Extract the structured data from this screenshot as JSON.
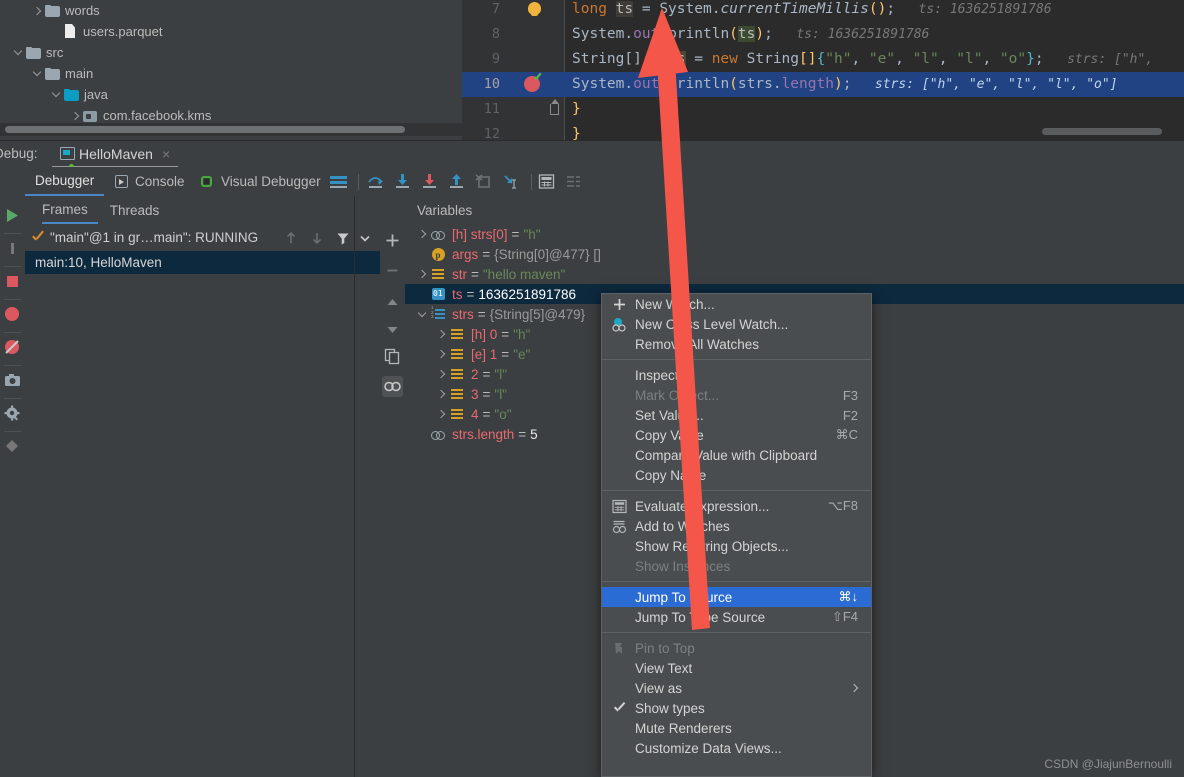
{
  "project_tree": {
    "items": [
      {
        "label": "words",
        "icon": "folder-icon",
        "indent": 1,
        "twisty": "right"
      },
      {
        "label": "users.parquet",
        "icon": "file-icon",
        "indent": 2,
        "twisty": "none"
      },
      {
        "label": "src",
        "icon": "folder-icon",
        "indent": 0,
        "twisty": "down"
      },
      {
        "label": "main",
        "icon": "folder-icon",
        "indent": 1,
        "twisty": "down"
      },
      {
        "label": "java",
        "icon": "source-folder-icon",
        "indent": 2,
        "twisty": "down"
      },
      {
        "label": "com.facebook.kms",
        "icon": "package-icon",
        "indent": 3,
        "twisty": "right"
      }
    ]
  },
  "editor": {
    "lines": [
      {
        "num": "7",
        "selected": false,
        "gutter": "bulb-icon",
        "tokens": [
          {
            "t": "long",
            "c": "k"
          },
          {
            "t": " ",
            "c": "pn"
          },
          {
            "t": "ts",
            "c": "varhl"
          },
          {
            "t": " = ",
            "c": "pn"
          },
          {
            "t": "System",
            "c": "cls"
          },
          {
            "t": ".",
            "c": "pn"
          },
          {
            "t": "currentTimeMillis",
            "c": "mtd"
          },
          {
            "t": "(",
            "c": "brk"
          },
          {
            "t": ")",
            "c": "brk"
          },
          {
            "t": ";",
            "c": "pn"
          }
        ],
        "hint": "ts: 1636251891786"
      },
      {
        "num": "8",
        "selected": false,
        "gutter": "none",
        "tokens": [
          {
            "t": "System",
            "c": "cls"
          },
          {
            "t": ".",
            "c": "pn"
          },
          {
            "t": "out",
            "c": "fld-i"
          },
          {
            "t": ".",
            "c": "pn"
          },
          {
            "t": "println",
            "c": "cls"
          },
          {
            "t": "(",
            "c": "brk"
          },
          {
            "t": "ts",
            "c": "varhl2"
          },
          {
            "t": ")",
            "c": "brk"
          },
          {
            "t": ";",
            "c": "pn"
          }
        ],
        "hint": "ts: 1636251891786"
      },
      {
        "num": "9",
        "selected": false,
        "gutter": "none",
        "tokens": [
          {
            "t": "String[]",
            "c": "cls"
          },
          {
            "t": " ",
            "c": "pn"
          },
          {
            "t": "strs",
            "c": "varhl3"
          },
          {
            "t": " = ",
            "c": "pn"
          },
          {
            "t": "new",
            "c": "k"
          },
          {
            "t": " ",
            "c": "pn"
          },
          {
            "t": "String",
            "c": "cls"
          },
          {
            "t": "[]",
            "c": "brk"
          },
          {
            "t": "{",
            "c": "br2"
          },
          {
            "t": "\"h\"",
            "c": "str"
          },
          {
            "t": ", ",
            "c": "pn"
          },
          {
            "t": "\"e\"",
            "c": "str"
          },
          {
            "t": ", ",
            "c": "pn"
          },
          {
            "t": "\"l\"",
            "c": "str"
          },
          {
            "t": ", ",
            "c": "pn"
          },
          {
            "t": "\"l\"",
            "c": "str"
          },
          {
            "t": ", ",
            "c": "pn"
          },
          {
            "t": "\"o\"",
            "c": "str"
          },
          {
            "t": "}",
            "c": "br2"
          },
          {
            "t": ";",
            "c": "pn"
          }
        ],
        "hint": "strs: [\"h\","
      },
      {
        "num": "10",
        "selected": true,
        "gutter": "breakpoint-verified-icon",
        "tokens": [
          {
            "t": "System",
            "c": "cls"
          },
          {
            "t": ".",
            "c": "pn"
          },
          {
            "t": "out",
            "c": "fld-i"
          },
          {
            "t": ".",
            "c": "pn"
          },
          {
            "t": "println",
            "c": "cls"
          },
          {
            "t": "(",
            "c": "brk"
          },
          {
            "t": "strs",
            "c": "pn"
          },
          {
            "t": ".",
            "c": "pn"
          },
          {
            "t": "length",
            "c": "fld"
          },
          {
            "t": ")",
            "c": "brk"
          },
          {
            "t": ";",
            "c": "pn"
          }
        ],
        "hint": "strs: [\"h\", \"e\", \"l\", \"l\", \"o\"]"
      },
      {
        "num": "11",
        "selected": false,
        "gutter": "fold-end-icon",
        "tokens": [
          {
            "t": "}",
            "c": "brk"
          }
        ],
        "hint": ""
      },
      {
        "num": "12",
        "selected": false,
        "gutter": "none",
        "tokens": [
          {
            "t": "}",
            "c": "brk"
          }
        ],
        "hint": ""
      }
    ]
  },
  "debug_panel": {
    "label": "Debug:",
    "session_tab": "HelloMaven",
    "session_close": "×",
    "tabs": [
      {
        "label": "Debugger",
        "icon": "none",
        "active": true
      },
      {
        "label": "Console",
        "icon": "console-icon",
        "active": false
      },
      {
        "label": "Visual Debugger",
        "icon": "visual-debugger-icon",
        "active": false
      }
    ],
    "toolbar_icons": [
      "layout-settings-icon",
      "step-over-icon",
      "step-into-icon",
      "force-step-into-icon",
      "step-out-icon",
      "drop-frame-icon",
      "run-to-cursor-icon",
      "evaluate-expression-icon",
      "trace-icon"
    ]
  },
  "frames": {
    "tabs": [
      {
        "label": "Frames",
        "active": true
      },
      {
        "label": "Threads",
        "active": false
      }
    ],
    "thread": "\"main\"@1 in gr…main\": RUNNING",
    "thread_icons": [
      "arrow-up-icon",
      "arrow-down-icon",
      "filter-icon",
      "chevron-down-icon"
    ],
    "stack": [
      {
        "label": "main:10, HelloMaven",
        "selected": true
      }
    ]
  },
  "vars_toolbar": {
    "icons": [
      "add-watch-icon",
      "remove-watch-icon",
      "move-up-icon",
      "move-down-icon",
      "copy-icon",
      "watches-icon"
    ]
  },
  "variables": {
    "header": "Variables",
    "rows": [
      {
        "indent": 0,
        "twisty": "right",
        "icon": "watch-icon",
        "prefix": "[h]",
        "name": "strs[0]",
        "eq": "=",
        "value": "\"h\"",
        "vtype": "string",
        "selected": false
      },
      {
        "indent": 0,
        "twisty": "none",
        "icon": "param-icon",
        "prefix": "",
        "name": "args",
        "eq": "=",
        "value": "{String[0]@477} []",
        "vtype": "object",
        "selected": false
      },
      {
        "indent": 0,
        "twisty": "right",
        "icon": "field-icon",
        "prefix": "",
        "name": "str",
        "eq": "=",
        "value": "\"hello maven\"",
        "vtype": "string",
        "selected": false
      },
      {
        "indent": 0,
        "twisty": "none",
        "icon": "number-icon",
        "prefix": "",
        "name": "ts",
        "eq": "=",
        "value": "1636251891786",
        "vtype": "number",
        "selected": true
      },
      {
        "indent": 0,
        "twisty": "down",
        "icon": "array-icon",
        "prefix": "",
        "name": "strs",
        "eq": "=",
        "value": "{String[5]@479}",
        "vtype": "object",
        "selected": false
      },
      {
        "indent": 1,
        "twisty": "right",
        "icon": "field-icon",
        "prefix": "[h]",
        "name": "0",
        "eq": "=",
        "value": "\"h\"",
        "vtype": "string",
        "selected": false
      },
      {
        "indent": 1,
        "twisty": "right",
        "icon": "field-icon",
        "prefix": "[e]",
        "name": "1",
        "eq": "=",
        "value": "\"e\"",
        "vtype": "string",
        "selected": false
      },
      {
        "indent": 1,
        "twisty": "right",
        "icon": "field-icon",
        "prefix": "",
        "name": "2",
        "eq": "=",
        "value": "\"l\"",
        "vtype": "string",
        "selected": false
      },
      {
        "indent": 1,
        "twisty": "right",
        "icon": "field-icon",
        "prefix": "",
        "name": "3",
        "eq": "=",
        "value": "\"l\"",
        "vtype": "string",
        "selected": false
      },
      {
        "indent": 1,
        "twisty": "right",
        "icon": "field-icon",
        "prefix": "",
        "name": "4",
        "eq": "=",
        "value": "\"o\"",
        "vtype": "string",
        "selected": false
      },
      {
        "indent": 0,
        "twisty": "none",
        "icon": "watch-icon",
        "prefix": "",
        "name": "strs.length",
        "eq": "=",
        "value": "5",
        "vtype": "number",
        "selected": false
      }
    ]
  },
  "context_menu": {
    "items": [
      {
        "label": "New Watch...",
        "icon": "plus-icon",
        "shortcut": "",
        "state": "normal"
      },
      {
        "label": "New Class Level Watch...",
        "icon": "class-watch-icon",
        "shortcut": "",
        "state": "normal"
      },
      {
        "label": "Remove All Watches",
        "icon": "none",
        "shortcut": "",
        "state": "normal"
      },
      {
        "separator": true
      },
      {
        "label": "Inspect...",
        "icon": "none",
        "shortcut": "",
        "state": "normal"
      },
      {
        "label": "Mark Object...",
        "icon": "none",
        "shortcut": "F3",
        "state": "disabled"
      },
      {
        "label": "Set Value...",
        "icon": "none",
        "shortcut": "F2",
        "state": "normal"
      },
      {
        "label": "Copy Value",
        "icon": "none",
        "shortcut": "⌘C",
        "state": "normal"
      },
      {
        "label": "Compare Value with Clipboard",
        "icon": "none",
        "shortcut": "",
        "state": "normal"
      },
      {
        "label": "Copy Name",
        "icon": "none",
        "shortcut": "",
        "state": "normal"
      },
      {
        "separator": true
      },
      {
        "label": "Evaluate Expression...",
        "icon": "evaluate-icon",
        "shortcut": "⌥F8",
        "state": "normal"
      },
      {
        "label": "Add to Watches",
        "icon": "add-watch-icon",
        "shortcut": "",
        "state": "normal"
      },
      {
        "label": "Show Referring Objects...",
        "icon": "none",
        "shortcut": "",
        "state": "normal"
      },
      {
        "label": "Show Instances",
        "icon": "none",
        "shortcut": "",
        "state": "disabled"
      },
      {
        "separator": true
      },
      {
        "label": "Jump To Source",
        "icon": "none",
        "shortcut": "⌘↓",
        "state": "highlighted"
      },
      {
        "label": "Jump To Type Source",
        "icon": "none",
        "shortcut": "⇧F4",
        "state": "normal"
      },
      {
        "separator": true
      },
      {
        "label": "Pin to Top",
        "icon": "pin-icon",
        "shortcut": "",
        "state": "disabled"
      },
      {
        "label": "View Text",
        "icon": "none",
        "shortcut": "",
        "state": "normal"
      },
      {
        "label": "View as",
        "icon": "none",
        "shortcut": "",
        "state": "submenu"
      },
      {
        "label": "Show types",
        "icon": "check-icon",
        "shortcut": "",
        "state": "checked"
      },
      {
        "label": "Mute Renderers",
        "icon": "none",
        "shortcut": "",
        "state": "normal"
      },
      {
        "label": "Customize Data Views...",
        "icon": "none",
        "shortcut": "",
        "state": "normal"
      }
    ]
  },
  "annotation": {
    "arrow_color": "#F4564A",
    "arrow_description": "red-arrow-pointing-up-from-jump-to-source-to-code-line-7"
  },
  "watermark": "CSDN @JiajunBernoulli",
  "colors": {
    "background": "#3C3F41",
    "editor_bg": "#2B2B2B",
    "selection_blue": "#214283",
    "menu_highlight": "#2B6CD4",
    "tree_selection": "#0D293E",
    "accent": "#4A88C7"
  }
}
